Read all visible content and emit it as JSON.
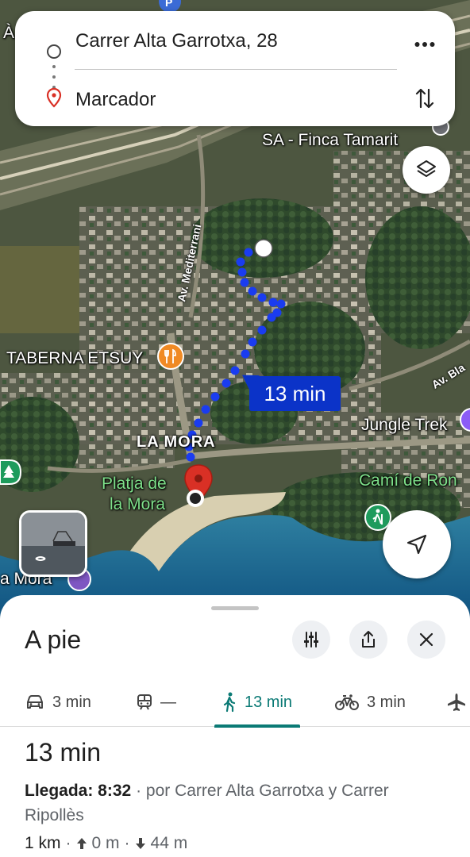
{
  "route": {
    "origin": "Carrer Alta Garrotxa, 28",
    "destination": "Marcador"
  },
  "map": {
    "labels": {
      "finca": "SA - Finca Tamarit",
      "taberna": "TABERNA ETSUY",
      "la_mora": "LA MORA",
      "platja_line1": "Platja de",
      "platja_line2": "la Mora",
      "jungle": "Jungle Trek",
      "cami": "Camí de Ron",
      "mora_edge": "a Mora",
      "a_edge": "À"
    },
    "roads": {
      "mediterrani": "Av. Mediterrani",
      "bla": "Av. Bla"
    },
    "route_time": "13 min",
    "route_color": "#1a3cf0"
  },
  "sheet": {
    "mode_title": "A pie",
    "tabs": {
      "car": "3 min",
      "transit": "—",
      "walk": "13 min",
      "bike": "3 min"
    },
    "summary": {
      "duration": "13 min",
      "arrival_label": "Llegada: 8:32",
      "via_text": "· por Carrer Alta Garrotxa y Carrer Ripollès",
      "distance": "1 km",
      "ascent": "0 m",
      "descent": "44 m"
    }
  },
  "colors": {
    "accent": "#0b7a75",
    "route_badge": "#0b33c8",
    "pin": "#d93025"
  }
}
